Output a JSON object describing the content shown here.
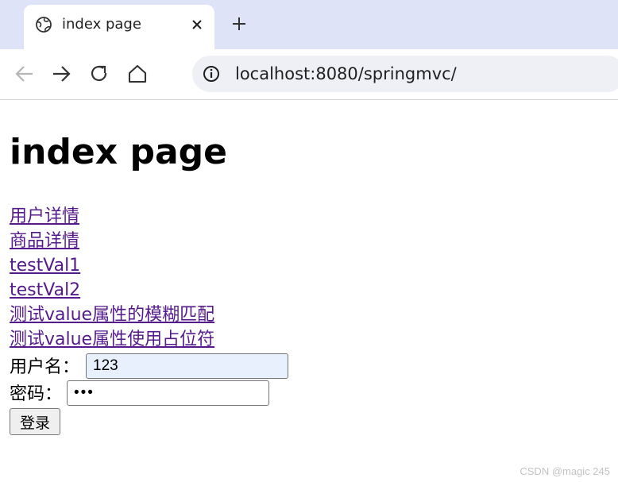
{
  "browser": {
    "tab_title": "index page",
    "url": "localhost:8080/springmvc/",
    "icons": {
      "favicon": "globe-icon",
      "close": "close-icon",
      "new_tab": "plus-icon",
      "back": "back-arrow-icon",
      "forward": "forward-arrow-icon",
      "reload": "reload-icon",
      "home": "home-icon",
      "site_info": "info-icon"
    }
  },
  "page": {
    "heading": "index page",
    "links": [
      "用户详情",
      "商品详情",
      "testVal1",
      "testVal2",
      "测试value属性的模糊匹配",
      "测试value属性使用占位符"
    ],
    "form": {
      "username_label": "用户名：",
      "username_value": "123",
      "password_label": "密码：",
      "password_value": "123",
      "submit_label": "登录"
    }
  },
  "watermark": "CSDN @magic 245",
  "colors": {
    "tabstrip_bg": "#dfe3f7",
    "link": "#551a8b",
    "autofill_bg": "#e8f0fe"
  }
}
